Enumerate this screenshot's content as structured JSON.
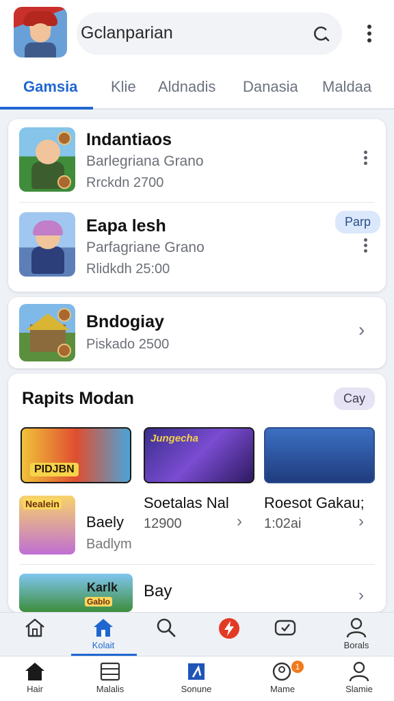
{
  "header": {
    "search_text": "Gclanparian",
    "avatar": "avatar",
    "icons": {
      "search": "search-icon",
      "more": "more-vert-icon"
    }
  },
  "tabs": [
    {
      "label": "Gamsia",
      "active": true
    },
    {
      "label": "Klie"
    },
    {
      "label": "Aldnadis"
    },
    {
      "label": "Danasia"
    },
    {
      "label": "Maldaa"
    }
  ],
  "games": [
    {
      "title": "Indantiaos",
      "subtitle": "Barlegriana Grano",
      "meta": "Rrckdn 2700"
    },
    {
      "title": "Eapa lesh",
      "subtitle": "Parfagriane Grano",
      "meta": "Rlidkdh 25:00",
      "action": "Parp"
    },
    {
      "title": "Bndogiay",
      "meta": "Piskado 2500"
    }
  ],
  "rapid": {
    "title": "Rapits Modan",
    "action": "Cay",
    "banner_texts": [
      "PIDJBN",
      "Jungecha"
    ],
    "items": [
      {
        "title": "Soetalas Nal",
        "value": "12900"
      },
      {
        "title": "Roesot Gakau;",
        "value": "1:02ai"
      },
      {
        "title": "Baely",
        "subtitle": "Badlym",
        "thumb_text": "Nealein"
      },
      {
        "title": "Bay",
        "thumb_text": "Karlk",
        "thumb_sub": "Gablo"
      }
    ]
  },
  "nav_primary": [
    {
      "label": "",
      "icon": "home-outline-icon"
    },
    {
      "label": "Kolait",
      "icon": "home-filled-icon",
      "active": true
    },
    {
      "label": "",
      "icon": "search-icon"
    },
    {
      "label": "",
      "icon": "bolt-icon"
    },
    {
      "label": "",
      "icon": "gamepad-icon"
    },
    {
      "label": "Borals",
      "icon": "user-icon"
    }
  ],
  "nav_secondary": [
    {
      "label": "Hair",
      "icon": "home-filled-icon"
    },
    {
      "label": "Malalis",
      "icon": "list-icon"
    },
    {
      "label": "Sonune",
      "icon": "store-icon"
    },
    {
      "label": "Mame",
      "icon": "profile-icon",
      "badge": "1"
    },
    {
      "label": "Slamie",
      "icon": "person-icon"
    }
  ],
  "colors": {
    "accent": "#1f66d1",
    "badge": "#f07a1a"
  }
}
